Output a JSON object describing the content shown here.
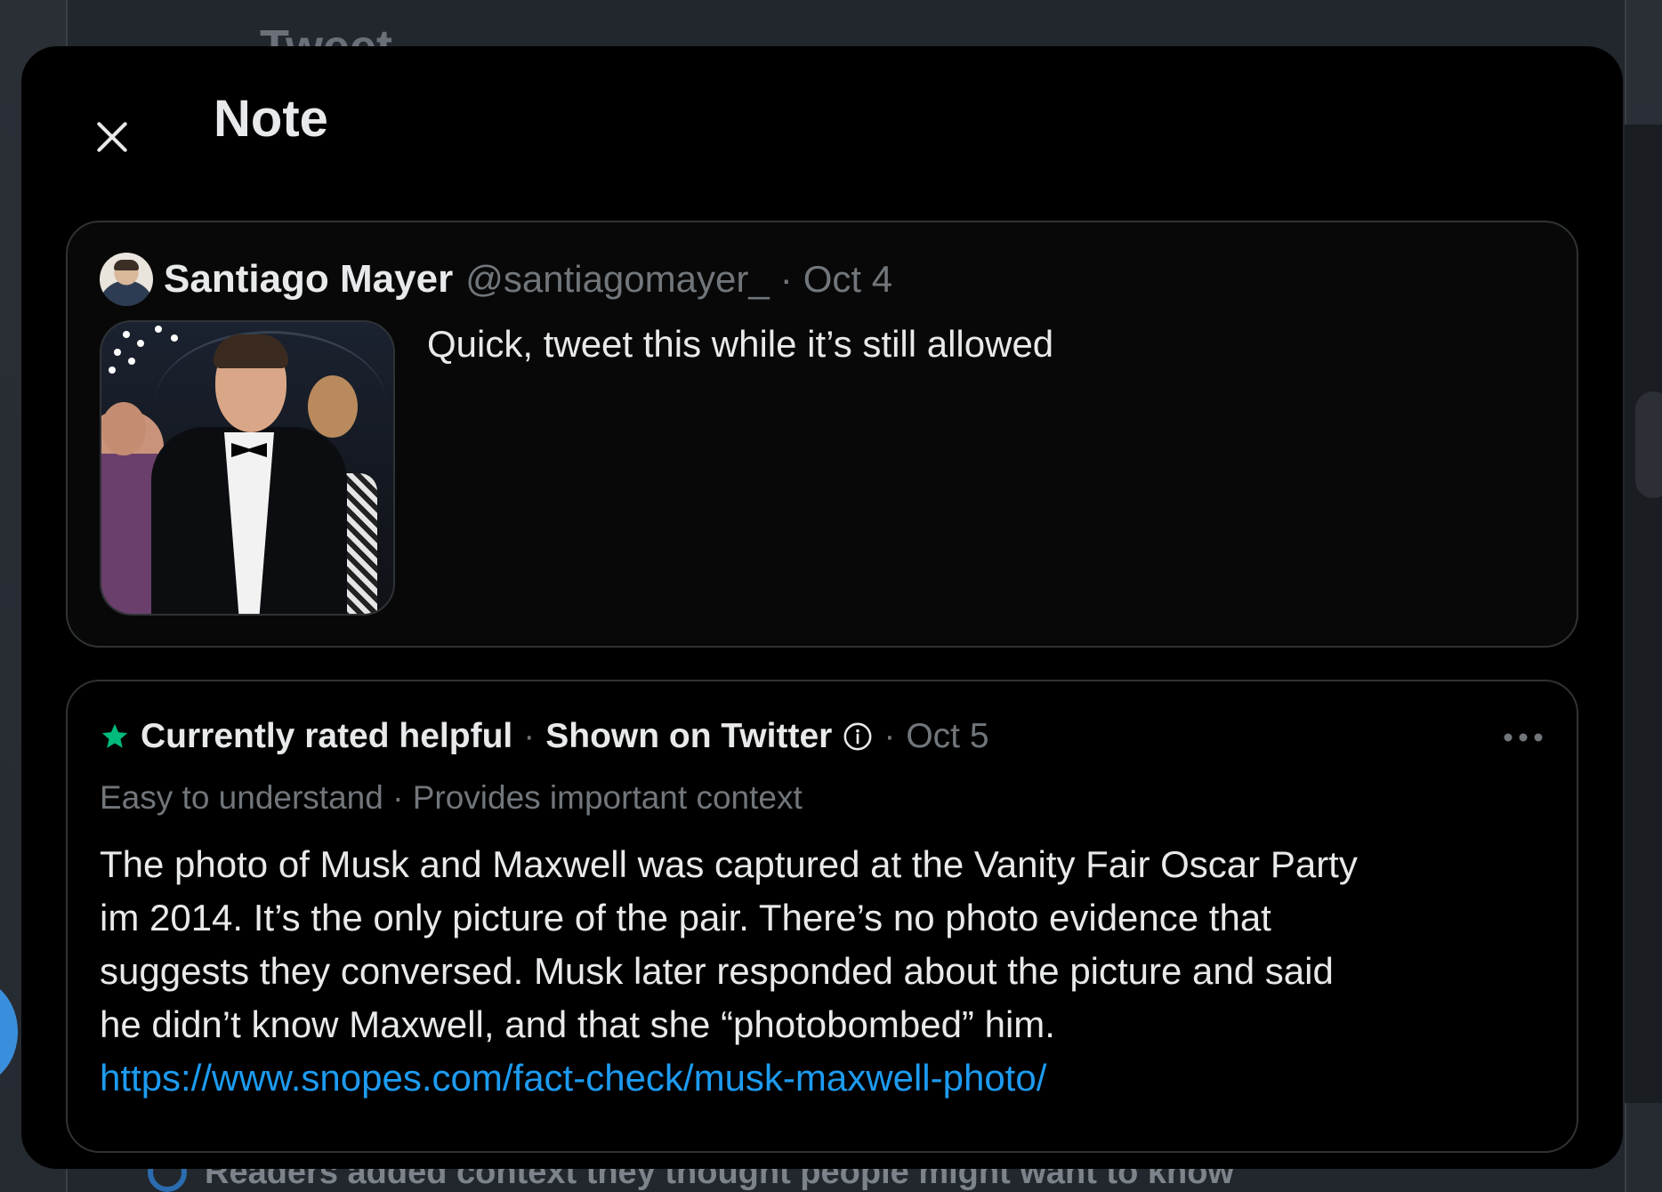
{
  "background": {
    "title": "Tweet",
    "context_banner": "Readers added context they thought people might want to know"
  },
  "modal": {
    "title": "Note",
    "close_label": "Close"
  },
  "tweet": {
    "author_name": "Santiago Mayer",
    "author_handle": "@santiagomayer_",
    "separator": "·",
    "date": "Oct 4",
    "text": "Quick, tweet this while it’s still allowed"
  },
  "note": {
    "status": "Currently rated helpful",
    "separator": "·",
    "shown": "Shown on Twitter",
    "date": "Oct 5",
    "tags": "Easy to understand · Provides important context",
    "body": "The photo of Musk and Maxwell was captured at the Vanity Fair Oscar Party im 2014. It’s the only picture of the pair. There’s no photo evidence that suggests they conversed. Musk later responded about the picture and said he didn’t know Maxwell, and that she “photobombed” him.",
    "link": "https://www.snopes.com/fact-check/musk-maxwell-photo/"
  },
  "icons": {
    "close": "close-icon",
    "star": "star-icon",
    "info": "info-icon",
    "more": "more-icon",
    "back": "back-arrow-icon",
    "context": "context-icon"
  },
  "colors": {
    "modal_bg": "#000000",
    "text_primary": "#e7e9ea",
    "text_secondary": "#71767b",
    "link": "#1d9bf0",
    "star": "#00ba7c",
    "border": "#2f3336"
  }
}
